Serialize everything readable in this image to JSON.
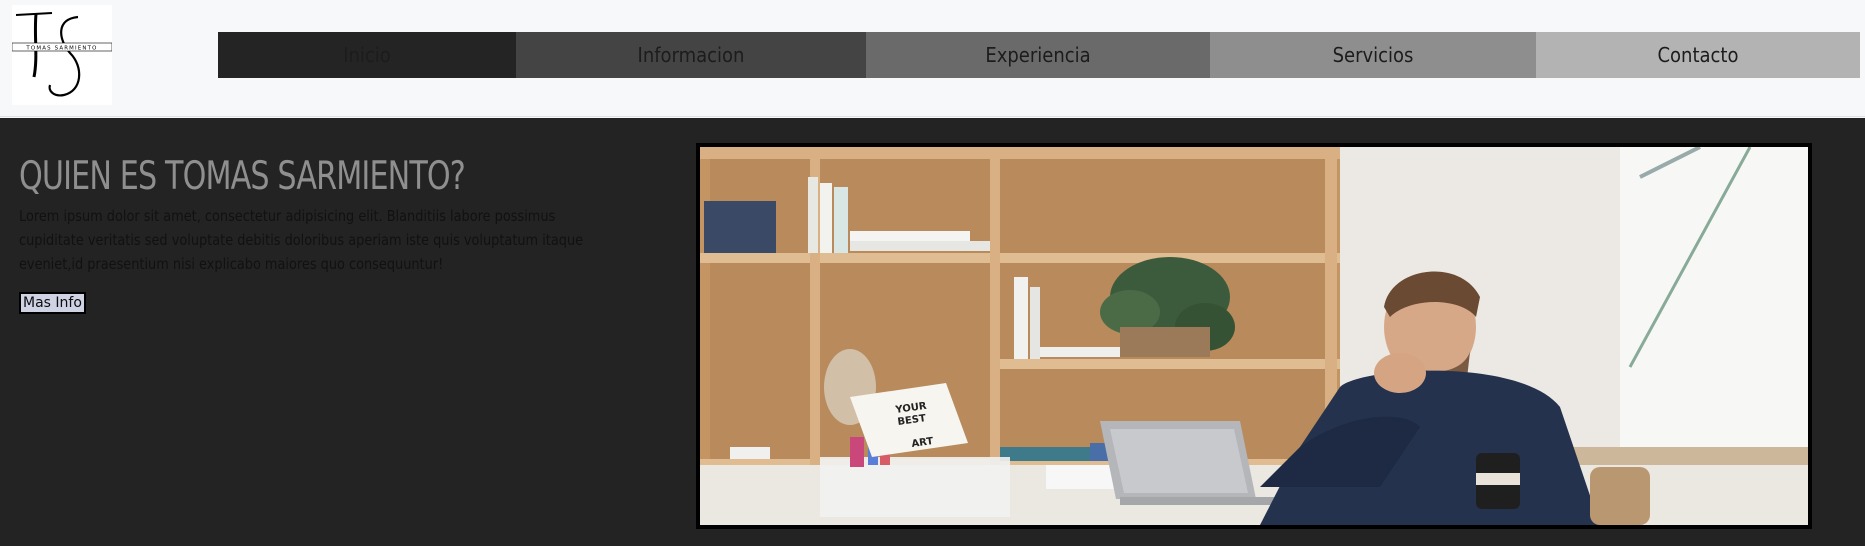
{
  "logo": {
    "initials": "TS",
    "name": "TOMAS SARMIENTO"
  },
  "nav": {
    "items": [
      {
        "label": "Inicio",
        "bg": "#242424"
      },
      {
        "label": "Informacion",
        "bg": "#444444"
      },
      {
        "label": "Experiencia",
        "bg": "#6a6a6a"
      },
      {
        "label": "Servicios",
        "bg": "#8e8e8e"
      },
      {
        "label": "Contacto",
        "bg": "#b3b3b3"
      }
    ]
  },
  "hero": {
    "title": "QUIEN ES TOMAS SARMIENTO?",
    "description": "Lorem ipsum dolor sit amet, consectetur adipisicing elit. Blanditiis labore possimus cupiditate veritatis sed voluptate debitis doloribus aperiam iste quis voluptatum itaque eveniet,id praesentium nisi explicabo maiores quo consequuntur!",
    "button_label": "Mas Info"
  },
  "photo": {
    "sign_text": [
      "YOUR",
      "BEST",
      "ART"
    ]
  },
  "colors": {
    "header_bg": "#f7f8fa",
    "main_bg": "#232323",
    "title": "#8f8f8f",
    "button_bg": "#cfd3e4"
  }
}
